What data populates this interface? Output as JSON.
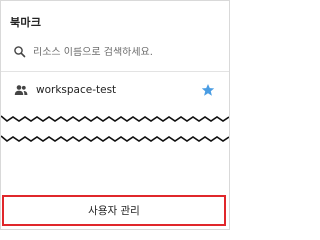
{
  "panel": {
    "title": "북마크"
  },
  "search": {
    "placeholder": "리소스 이름으로 검색하세요.",
    "value": "",
    "icon": "search-icon"
  },
  "bookmarks": [
    {
      "label": "workspace-test",
      "icon": "group-icon",
      "starred": true
    }
  ],
  "footer": {
    "button_label": "사용자 관리"
  },
  "colors": {
    "star": "#4a9de3",
    "highlight_border": "#e0272b"
  }
}
